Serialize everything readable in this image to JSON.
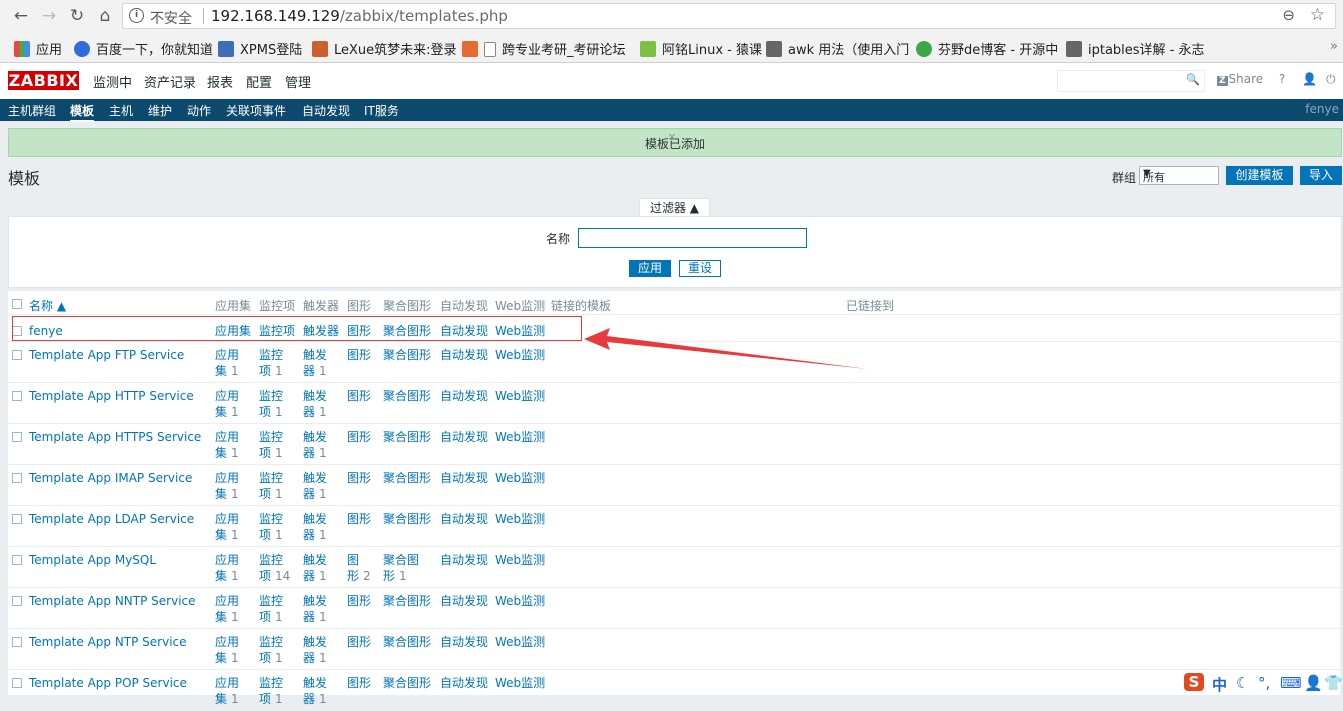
{
  "browser": {
    "insecure_label": "不安全",
    "url_host": "192.168.149.129",
    "url_path": "/zabbix/templates.php",
    "bookmarks": [
      "应用",
      "百度一下，你就知道",
      "XPMS登陆",
      "LeXue筑梦未来:登录",
      "跨专业考研_考研论坛",
      "阿铭Linux - 猿课",
      "awk 用法（使用入门",
      "芬野de博客 - 开源中",
      "iptables详解 - 永志"
    ]
  },
  "header": {
    "logo": "ZABBIX",
    "menu": [
      "监测中",
      "资产记录",
      "报表",
      "配置",
      "管理"
    ],
    "share_label": "Share",
    "help": "?"
  },
  "submenu": {
    "items": [
      "主机群组",
      "模板",
      "主机",
      "维护",
      "动作",
      "关联项事件",
      "自动发现",
      "IT服务"
    ],
    "user": "fenye"
  },
  "message": {
    "text": "模板已添加"
  },
  "page": {
    "title": "模板",
    "group_label": "群组",
    "group_value": "所有",
    "create_btn": "创建模板",
    "import_btn": "导入"
  },
  "filter": {
    "tab": "过滤器 ▲",
    "name_label": "名称",
    "name_value": "",
    "apply": "应用",
    "reset": "重设"
  },
  "table": {
    "headers": [
      "名称 ▲",
      "应用集",
      "监控项",
      "触发器",
      "图形",
      "聚合图形",
      "自动发现",
      "Web监测",
      "链接的模板",
      "已链接到"
    ],
    "rows": [
      {
        "name": "fenye",
        "app": "应用集",
        "app_n": "",
        "items": "监控项",
        "items_n": "",
        "triggers": "触发器",
        "triggers_n": "",
        "graphs": "图形",
        "graphs_n": "",
        "screens": "聚合图形",
        "screens_n": "",
        "disc": "自动发现",
        "web": "Web监测"
      },
      {
        "name": "Template App FTP Service",
        "app": "应用",
        "app2": "集",
        "app_n": "1",
        "items": "监控",
        "items2": "项",
        "items_n": "1",
        "triggers": "触发",
        "triggers2": "器",
        "triggers_n": "1",
        "graphs": "图形",
        "graphs_n": "",
        "screens": "聚合图形",
        "screens_n": "",
        "disc": "自动发现",
        "web": "Web监测"
      },
      {
        "name": "Template App HTTP Service",
        "app": "应用",
        "app2": "集",
        "app_n": "1",
        "items": "监控",
        "items2": "项",
        "items_n": "1",
        "triggers": "触发",
        "triggers2": "器",
        "triggers_n": "1",
        "graphs": "图形",
        "graphs_n": "",
        "screens": "聚合图形",
        "screens_n": "",
        "disc": "自动发现",
        "web": "Web监测"
      },
      {
        "name": "Template App HTTPS Service",
        "app": "应用",
        "app2": "集",
        "app_n": "1",
        "items": "监控",
        "items2": "项",
        "items_n": "1",
        "triggers": "触发",
        "triggers2": "器",
        "triggers_n": "1",
        "graphs": "图形",
        "graphs_n": "",
        "screens": "聚合图形",
        "screens_n": "",
        "disc": "自动发现",
        "web": "Web监测"
      },
      {
        "name": "Template App IMAP Service",
        "app": "应用",
        "app2": "集",
        "app_n": "1",
        "items": "监控",
        "items2": "项",
        "items_n": "1",
        "triggers": "触发",
        "triggers2": "器",
        "triggers_n": "1",
        "graphs": "图形",
        "graphs_n": "",
        "screens": "聚合图形",
        "screens_n": "",
        "disc": "自动发现",
        "web": "Web监测"
      },
      {
        "name": "Template App LDAP Service",
        "app": "应用",
        "app2": "集",
        "app_n": "1",
        "items": "监控",
        "items2": "项",
        "items_n": "1",
        "triggers": "触发",
        "triggers2": "器",
        "triggers_n": "1",
        "graphs": "图形",
        "graphs_n": "",
        "screens": "聚合图形",
        "screens_n": "",
        "disc": "自动发现",
        "web": "Web监测"
      },
      {
        "name": "Template App MySQL",
        "app": "应用",
        "app2": "集",
        "app_n": "1",
        "items": "监控",
        "items2": "项",
        "items_n": "14",
        "triggers": "触发",
        "triggers2": "器",
        "triggers_n": "1",
        "graphs": "图",
        "graphs2": "形",
        "graphs_n": "2",
        "screens": "聚合图",
        "screens2": "形",
        "screens_n": "1",
        "disc": "自动发现",
        "web": "Web监测"
      },
      {
        "name": "Template App NNTP Service",
        "app": "应用",
        "app2": "集",
        "app_n": "1",
        "items": "监控",
        "items2": "项",
        "items_n": "1",
        "triggers": "触发",
        "triggers2": "器",
        "triggers_n": "1",
        "graphs": "图形",
        "graphs_n": "",
        "screens": "聚合图形",
        "screens_n": "",
        "disc": "自动发现",
        "web": "Web监测"
      },
      {
        "name": "Template App NTP Service",
        "app": "应用",
        "app2": "集",
        "app_n": "1",
        "items": "监控",
        "items2": "项",
        "items_n": "1",
        "triggers": "触发",
        "triggers2": "器",
        "triggers_n": "1",
        "graphs": "图形",
        "graphs_n": "",
        "screens": "聚合图形",
        "screens_n": "",
        "disc": "自动发现",
        "web": "Web监测"
      },
      {
        "name": "Template App POP Service",
        "app": "应用",
        "app2": "集",
        "app_n": "1",
        "items": "监控",
        "items2": "项",
        "items_n": "1",
        "triggers": "触发",
        "triggers2": "器",
        "triggers_n": "1",
        "graphs": "图形",
        "graphs_n": "",
        "screens": "聚合图形",
        "screens_n": "",
        "disc": "自动发现",
        "web": "Web监测"
      }
    ]
  },
  "tray": {
    "ime": "中"
  }
}
